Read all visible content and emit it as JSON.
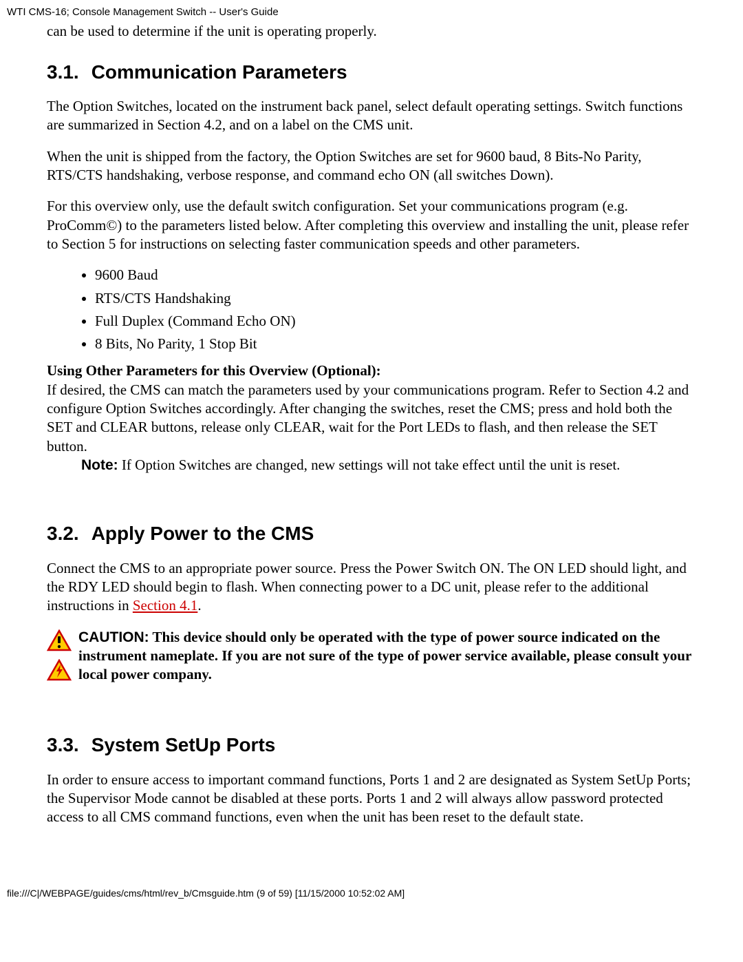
{
  "header": {
    "title": "WTI CMS-16; Console Management Switch -- User's Guide"
  },
  "intro": "can be used to determine if the unit is operating properly.",
  "section31": {
    "number": "3.1.",
    "title": "Communication Parameters",
    "p1": "The Option Switches, located on the instrument back panel, select default operating settings.  Switch functions are summarized in Section 4.2, and on a label on the CMS unit.",
    "p2": "When the unit is shipped from the factory, the Option Switches are set for 9600 baud, 8 Bits-No Parity, RTS/CTS handshaking, verbose response, and command echo ON (all switches Down).",
    "p3": "For this overview only, use the default switch configuration.  Set your communications program (e.g. ProComm©) to the parameters listed below. After completing this overview and installing the unit, please refer to Section 5 for instructions on selecting faster communication speeds and other parameters.",
    "bullets": [
      "9600 Baud",
      "RTS/CTS Handshaking",
      "Full Duplex (Command Echo ON)",
      "8 Bits, No Parity, 1 Stop Bit"
    ],
    "subhead": "Using Other Parameters for this Overview (Optional):",
    "p4": "If desired, the CMS can match the parameters used by your communications program.  Refer to Section 4.2 and configure Option Switches accordingly.  After changing the switches, reset the CMS; press and hold both the SET and CLEAR buttons, release only CLEAR, wait for the Port LEDs to flash, and then release the SET button.",
    "note_label": "Note:",
    "note_text": "  If Option Switches are changed, new settings will not take effect until the unit is reset."
  },
  "section32": {
    "number": "3.2.",
    "title": "Apply Power to the CMS",
    "p1_a": "Connect the CMS to an appropriate power source. Press the Power Switch ON.  The ON LED should light, and the RDY LED should begin to flash. When connecting power to a DC unit, please refer to the additional instructions in ",
    "link_text": "Section 4.1",
    "p1_b": ".",
    "caution_label": "CAUTION:",
    "caution_text": "  This device should only be operated with the type of power source indicated on the instrument nameplate. If you are not sure of the type of power service available, please consult your local power company."
  },
  "section33": {
    "number": "3.3.",
    "title": "System SetUp Ports",
    "p1": "In order to ensure access to important command functions, Ports 1 and 2 are designated as System SetUp Ports; the Supervisor Mode cannot be disabled at these ports. Ports 1 and 2 will always allow password protected access to all CMS command functions, even when the unit has been reset to the default state."
  },
  "footer": "file:///C|/WEBPAGE/guides/cms/html/rev_b/Cmsguide.htm (9 of 59) [11/15/2000 10:52:02 AM]"
}
